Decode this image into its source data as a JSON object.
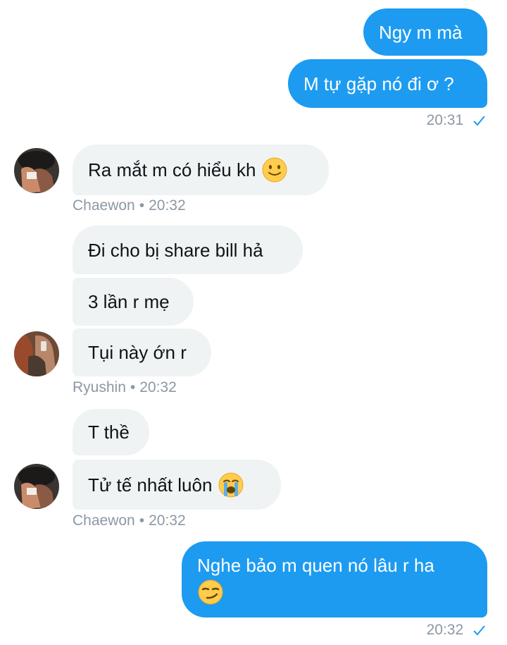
{
  "messages": [
    {
      "text": "Ngy m mà"
    },
    {
      "text": "M tự gặp nó đi ơ ?",
      "time": "20:31"
    },
    {
      "text": "Ra mắt m có hiểu kh",
      "emoji": "slightly-smiling-face-icon"
    },
    {
      "sender": "Chaewon",
      "time": "20:32"
    },
    {
      "text": "Đi cho bị share bill hả"
    },
    {
      "text": "3 lần r mẹ"
    },
    {
      "text": "Tụi này ớn r"
    },
    {
      "sender": "Ryushin",
      "time": "20:32"
    },
    {
      "text": "T thề"
    },
    {
      "text": "Tử tế nhất luôn",
      "emoji": "loudly-crying-face-icon"
    },
    {
      "sender": "Chaewon",
      "time": "20:32"
    },
    {
      "text": "Nghe bảo m quen nó lâu r ha",
      "emoji": "smirking-face-icon",
      "time": "20:32"
    }
  ],
  "meta": {
    "dot": "•"
  },
  "colors": {
    "sent_bubble": "#1d9bf0",
    "received_bubble": "#eff3f4",
    "meta_text": "#8b98a5",
    "check": "#1d9bf0"
  }
}
